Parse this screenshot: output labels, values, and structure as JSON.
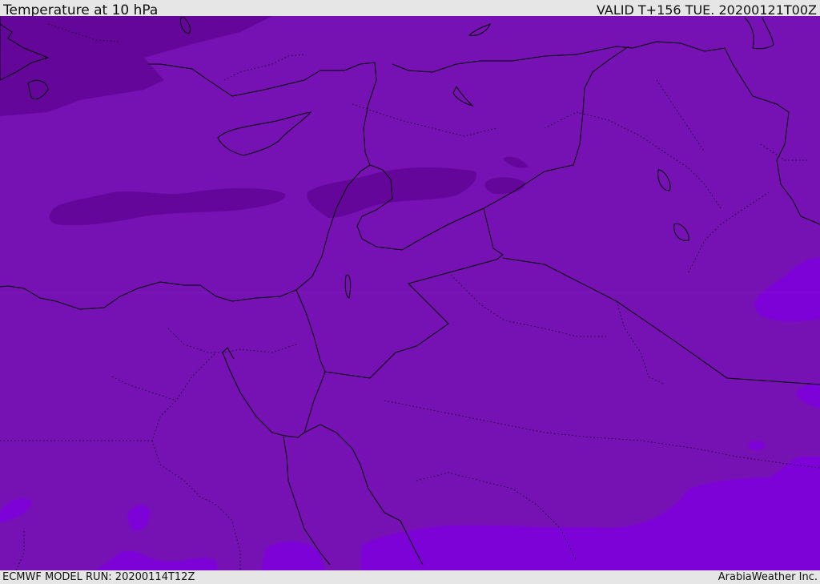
{
  "header": {
    "title": "Temperature at 10 hPa",
    "valid": "VALID T+156 TUE. 20200121T00Z"
  },
  "footer": {
    "model_run": "ECMWF MODEL RUN: 20200114T12Z",
    "credit": "ArabiaWeather Inc."
  },
  "colors": {
    "base_fill": "#7612b4",
    "cold_fill": "#64069a",
    "warm_fill": "#7d02d8",
    "line": "#000000",
    "bar_bg": "#e6e6e6"
  }
}
